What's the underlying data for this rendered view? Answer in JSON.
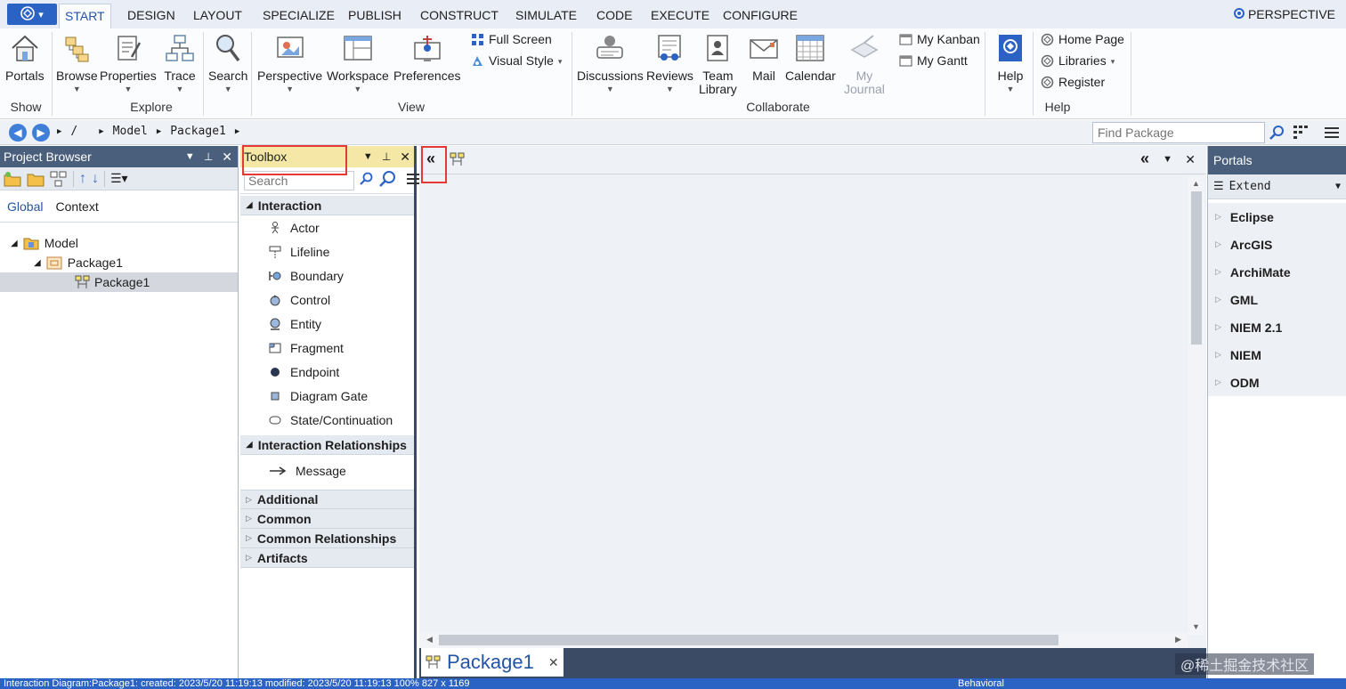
{
  "menu": {
    "tabs": [
      "START",
      "DESIGN",
      "LAYOUT",
      "SPECIALIZE",
      "PUBLISH",
      "CONSTRUCT",
      "SIMULATE",
      "CODE",
      "EXECUTE",
      "CONFIGURE"
    ],
    "perspective": "PERSPECTIVE"
  },
  "ribbon": {
    "show": {
      "portals": "Portals",
      "label": "Show"
    },
    "explore": {
      "browse": "Browse",
      "properties": "Properties",
      "trace": "Trace",
      "search": "Search",
      "label": "Explore"
    },
    "view": {
      "perspective": "Perspective",
      "workspace": "Workspace",
      "preferences": "Preferences",
      "full_screen": "Full Screen",
      "visual_style": "Visual Style",
      "label": "View"
    },
    "collaborate": {
      "discussions": "Discussions",
      "reviews": "Reviews",
      "team_library_1": "Team",
      "team_library_2": "Library",
      "mail": "Mail",
      "calendar": "Calendar",
      "journal_1": "My",
      "journal_2": "Journal",
      "kanban": "My Kanban",
      "gantt": "My Gantt",
      "label": "Collaborate"
    },
    "help": {
      "help": "Help",
      "home_page": "Home Page",
      "libraries": "Libraries",
      "register": "Register",
      "label": "Help"
    }
  },
  "address": {
    "crumbs": [
      "/",
      "Model",
      "Package1"
    ],
    "find_placeholder": "Find Package"
  },
  "project_browser": {
    "title": "Project Browser",
    "tabs": [
      "Global",
      "Context"
    ],
    "tree": [
      "Model",
      "Package1",
      "Package1"
    ]
  },
  "toolbox": {
    "title": "Toolbox",
    "search_placeholder": "Search",
    "interaction": {
      "label": "Interaction",
      "items": [
        "Actor",
        "Lifeline",
        "Boundary",
        "Control",
        "Entity",
        "Fragment",
        "Endpoint",
        "Diagram Gate",
        "State/Continuation"
      ]
    },
    "interaction_relationships": {
      "label": "Interaction Relationships",
      "items": [
        "Message"
      ]
    },
    "collapsed": [
      "Additional",
      "Common",
      "Common Relationships",
      "Artifacts"
    ]
  },
  "diagram": {
    "tab_label": "Package1"
  },
  "portals": {
    "title": "Portals",
    "dropdown": "Extend",
    "items": [
      "Eclipse",
      "ArcGIS",
      "ArchiMate",
      "GML",
      "NIEM 2.1",
      "NIEM",
      "ODM"
    ]
  },
  "statusbar": {
    "text": "Interaction Diagram:Package1:  created: 2023/5/20 11:19:13  modified: 2023/5/20 11:19:13   100%   827 x 1169",
    "mode": "Behavioral"
  },
  "watermark": "@稀土掘金技术社区",
  "colors": {
    "accent": "#2b63c4",
    "panel_header": "#4a5f7c",
    "toolbox_header": "#f5e8a6",
    "highlight": "#e53935"
  }
}
